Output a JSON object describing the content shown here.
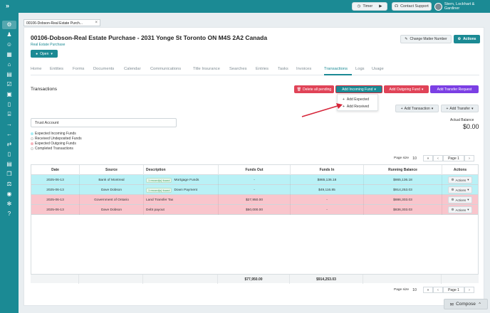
{
  "topbar": {
    "expand_icon": "chevrons-right-icon",
    "timer_label": "Timer",
    "support_label": "Contact Support",
    "user_name": "Stern, Lockhart & Gardiner"
  },
  "doc_tab": {
    "label": "00106-Dobson-Real Estate Purch..."
  },
  "matter": {
    "title": "00106-Dobson-Real Estate Purchase - 2031 Yonge St Toronto ON M4S 2A2 Canada",
    "subtitle": "Real Estate Purchase",
    "status_label": "Open",
    "change_number_label": "Change Matter Number",
    "actions_label": "Actions"
  },
  "tabs": [
    "Home",
    "Entities",
    "Forms",
    "Documents",
    "Calendar",
    "Communications",
    "Title Insurance",
    "Searches",
    "Entries",
    "Tasks",
    "Invoices",
    "Transactions",
    "Logs",
    "Usage"
  ],
  "active_tab": "Transactions",
  "section": {
    "title": "Transactions",
    "delete_label": "Delete all pending",
    "incoming_label": "Add Incoming Fund",
    "outgoing_label": "Add Outgoing Fund",
    "transfer_label": "Add Transfer Request",
    "dropdown": [
      "Add Expected",
      "Add Received"
    ],
    "add_transaction_label": "Add Transaction",
    "add_transfer_label": "Add Transfer",
    "trust_account_label": "Trust Account",
    "legend": [
      {
        "label": "Expected Incoming Funds",
        "color": "#a8eef5"
      },
      {
        "label": "Received Undeposited Funds",
        "color": "#ffffff"
      },
      {
        "label": "Expected Outgoing Funds",
        "color": "#f7b5bd"
      },
      {
        "label": "Completed Transactions",
        "color": "#ffffff"
      }
    ],
    "balance_label": "Actual Balance",
    "balance_value": "$0.00"
  },
  "pager": {
    "size_label": "Page size",
    "size_value": "10",
    "page_label": "Page 1"
  },
  "table": {
    "headers": [
      "Date",
      "Source",
      "Description",
      "Funds Out",
      "Funds In",
      "Running Balance",
      "Actions"
    ],
    "rows": [
      {
        "date": "2025-06-13",
        "source": "Bank of Montreal",
        "found": "1 record(s) found",
        "desc": "Mortgage Funds",
        "out": "-",
        "in": "$865,136.18",
        "bal": "$865,136.18",
        "act": "Actions"
      },
      {
        "date": "2025-06-13",
        "source": "Dave Dobson",
        "found": "1 record(s) found",
        "desc": "Down Payment",
        "out": "-",
        "in": "$49,116.85",
        "bal": "$914,253.03",
        "act": "Actions"
      },
      {
        "date": "2025-06-13",
        "source": "Government of Ontario",
        "found": "",
        "desc": "Land Transfer Tax",
        "out": "$27,950.00",
        "in": "-",
        "bal": "$886,303.03",
        "act": "Actions"
      },
      {
        "date": "2025-06-13",
        "source": "Dave Dobson",
        "found": "",
        "desc": "Debt payout",
        "out": "$50,000.00",
        "in": "-",
        "bal": "$836,303.03",
        "act": "Actions"
      }
    ],
    "row_colors": [
      "#b9f1f6",
      "#b9f1f6",
      "#f9c5cc",
      "#f9c5cc"
    ],
    "totals": {
      "out": "$77,950.00",
      "in": "$914,253.03"
    }
  },
  "compose_label": "Compose",
  "colors": {
    "teal": "#1b8a94",
    "red": "#e04357",
    "purple": "#7b3fe4"
  }
}
